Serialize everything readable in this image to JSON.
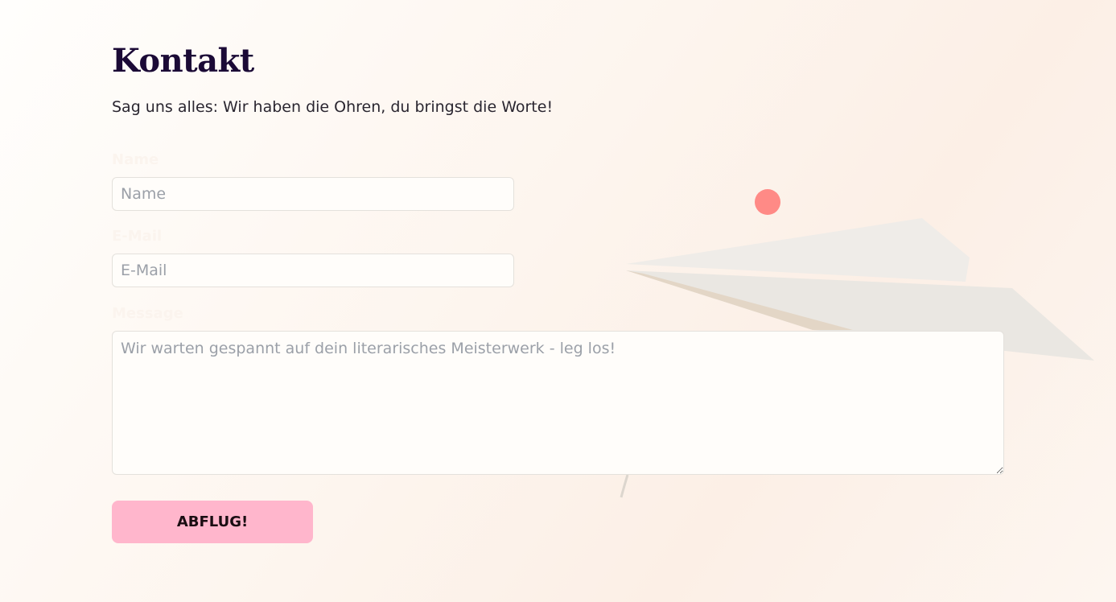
{
  "page": {
    "title": "Kontakt",
    "subtitle": "Sag uns alles: Wir haben die Ohren, du bringst die Worte!"
  },
  "form": {
    "name": {
      "label": "Name",
      "placeholder": "Name",
      "value": ""
    },
    "email": {
      "label": "E-Mail",
      "placeholder": "E-Mail",
      "value": ""
    },
    "message": {
      "label": "Message",
      "placeholder": "Wir warten gespannt auf dein literarisches Meisterwerk - leg los!",
      "value": ""
    },
    "submit_label": "ABFLUG!"
  },
  "colors": {
    "title": "#1b0a36",
    "accent_button": "#ffb6cc",
    "dot": "#ff8a86"
  },
  "decoration": {
    "icon": "paper-plane-icon"
  }
}
